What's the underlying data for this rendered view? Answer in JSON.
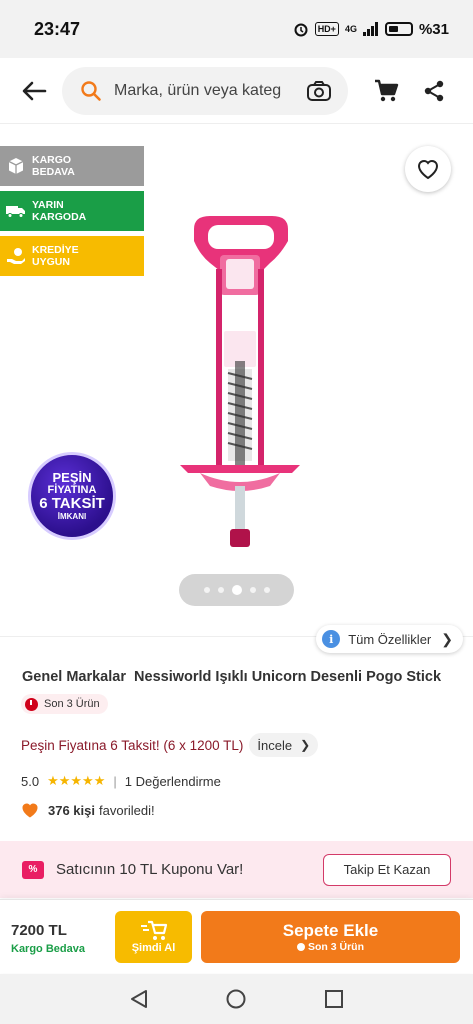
{
  "status_bar": {
    "time": "23:47",
    "network": "4G",
    "hd_label": "HD+",
    "battery": "%31"
  },
  "header": {
    "search_placeholder": "Marka, ürün veya kateg...",
    "icons": [
      "back-arrow-icon",
      "search-icon",
      "camera-icon",
      "cart-icon",
      "share-icon"
    ]
  },
  "gallery": {
    "badges": [
      {
        "line1": "KARGO",
        "line2": "BEDAVA",
        "color": "#9b9b9b",
        "icon": "box-icon"
      },
      {
        "line1": "YARIN",
        "line2": "KARGODA",
        "color": "#1a9e47",
        "icon": "truck-icon"
      },
      {
        "line1": "KREDİYE",
        "line2": "UYGUN",
        "color": "#f7bb00",
        "icon": "hand-coin-icon"
      }
    ],
    "sticker": {
      "l1": "PEŞİN",
      "l2": "FİYATINA",
      "l3": "6 TAKSİT",
      "l4": "İMKANI"
    },
    "dots_count": 5,
    "active_dot": 3
  },
  "product": {
    "all_specs_label": "Tüm Özellikler",
    "brand": "Genel Markalar",
    "name": "Nessiworld Işıklı Unicorn Desenli Pogo Stick",
    "stock_badge": "Son 3 Ürün",
    "installment_text": "Peşin Fiyatına 6 Taksit! (6 x 1200 TL)",
    "incele_label": "İncele",
    "rating": "5.0",
    "stars": "★★★★★",
    "review_count_label": "1 Değerlendirme",
    "favorite_count": "376 kişi",
    "favorite_text": "favoriledi!"
  },
  "coupon": {
    "text": "Satıcının 10 TL Kuponu Var!",
    "button_label": "Takip Et Kazan"
  },
  "bottom_bar": {
    "price": "7200 TL",
    "shipping": "Kargo Bedava",
    "buy_now_label": "Şimdi Al",
    "add_to_cart_label": "Sepete Ekle",
    "add_to_cart_sub": "Son 3 Ürün"
  },
  "colors": {
    "brand_orange": "#f27a1a",
    "badge_green": "#1a9e47",
    "badge_yellow": "#f7bb00",
    "coupon_pink": "#d33a68"
  }
}
